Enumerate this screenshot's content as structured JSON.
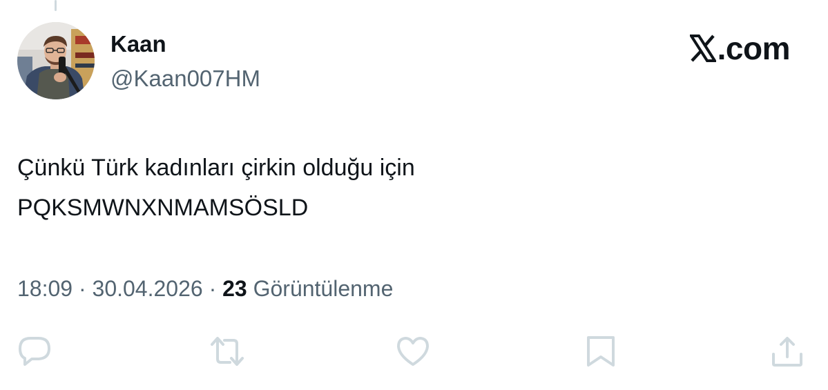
{
  "author": {
    "display_name": "Kaan",
    "handle": "@Kaan007HM",
    "avatar": "profile-photo"
  },
  "brand": {
    "logo_icon": "x-logo-icon",
    "text": ".com"
  },
  "tweet": {
    "line1": "Çünkü Türk kadınları çirkin olduğu için",
    "line2": "PQKSMWNXNMAMSÖSLD"
  },
  "meta": {
    "time": "18:09",
    "date": "30.04.2026",
    "separator": "·",
    "views_count": "23",
    "views_label": "Görüntülenme"
  },
  "actions": [
    {
      "icon": "reply-icon"
    },
    {
      "icon": "retweet-icon"
    },
    {
      "icon": "like-icon"
    },
    {
      "icon": "bookmark-icon"
    },
    {
      "icon": "share-icon"
    }
  ],
  "colors": {
    "primary_text": "#0f1419",
    "secondary_text": "#536471",
    "icon_gray": "#cfd9de"
  }
}
